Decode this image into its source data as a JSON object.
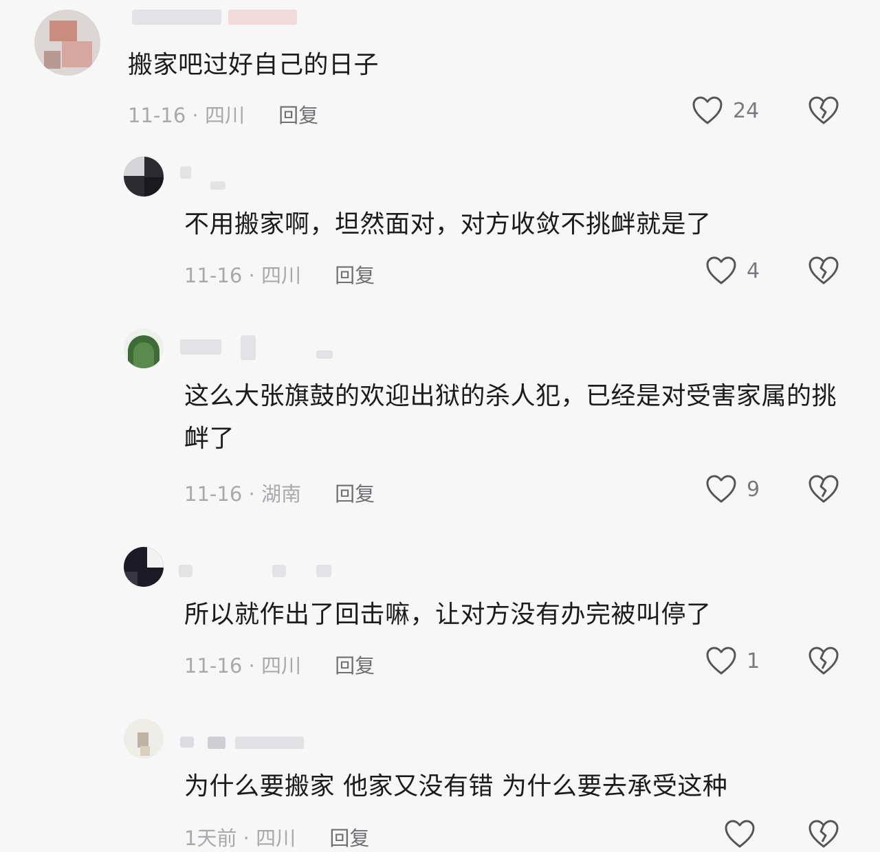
{
  "comments": [
    {
      "text": "搬家吧过好自己的日子",
      "date": "11-16",
      "location": "四川",
      "reply_label": "回复",
      "likes": "24"
    },
    {
      "text": "不用搬家啊，坦然面对，对方收敛不挑衅就是了",
      "date": "11-16",
      "location": "四川",
      "reply_label": "回复",
      "likes": "4"
    },
    {
      "text": "这么大张旗鼓的欢迎出狱的杀人犯，已经是对受害家属的挑衅了",
      "date": "11-16",
      "location": "湖南",
      "reply_label": "回复",
      "likes": "9"
    },
    {
      "text": "所以就作出了回击嘛，让对方没有办完被叫停了",
      "date": "11-16",
      "location": "四川",
      "reply_label": "回复",
      "likes": "1"
    },
    {
      "text": "为什么要搬家 他家又没有错 为什么要去承受这种",
      "date": "1天前",
      "location": "四川",
      "reply_label": "回复",
      "likes": ""
    }
  ],
  "meta_separator": "·",
  "icons": {
    "like": "heart-outline-icon",
    "dislike": "broken-heart-icon"
  },
  "colors": {
    "background": "#f7f7f8",
    "text": "#1b1b1b",
    "meta": "#a9a9ad",
    "icon": "#555558"
  }
}
